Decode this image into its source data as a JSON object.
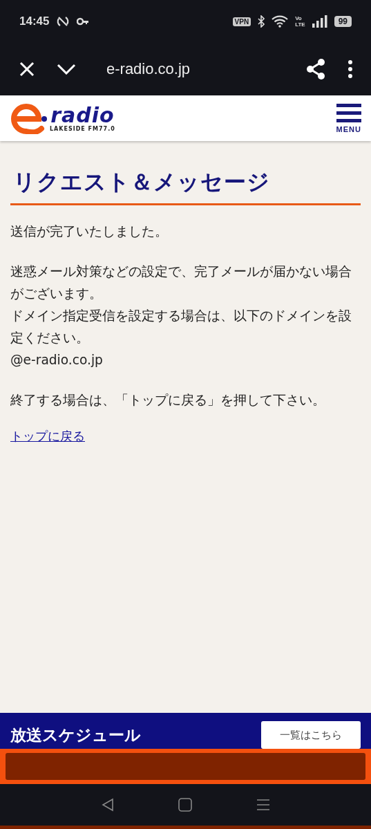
{
  "status_bar": {
    "time": "14:45",
    "vpn": "VPN",
    "volte_top": "Vo",
    "volte_bottom": "LTE",
    "battery": "99"
  },
  "browser_toolbar": {
    "url": "e-radio.co.jp"
  },
  "site_header": {
    "logo_word": "radio",
    "logo_tagline": "LAKESIDE FM77.0",
    "menu_label": "MENU"
  },
  "page": {
    "title": "リクエスト＆メッセージ",
    "paragraphs": [
      {
        "lines": [
          "送信が完了いたしました。"
        ]
      },
      {
        "lines": [
          "迷惑メール対策などの設定で、完了メールが届かない場合がございます。",
          "ドメイン指定受信を設定する場合は、以下のドメインを設定ください。",
          "@e-radio.co.jp"
        ]
      },
      {
        "lines": [
          "終了する場合は、「トップに戻る」を押して下さい。"
        ]
      }
    ],
    "link": "トップに戻る"
  },
  "schedule_bar": {
    "title": "放送スケジュール",
    "button": "一覧はこちら"
  }
}
